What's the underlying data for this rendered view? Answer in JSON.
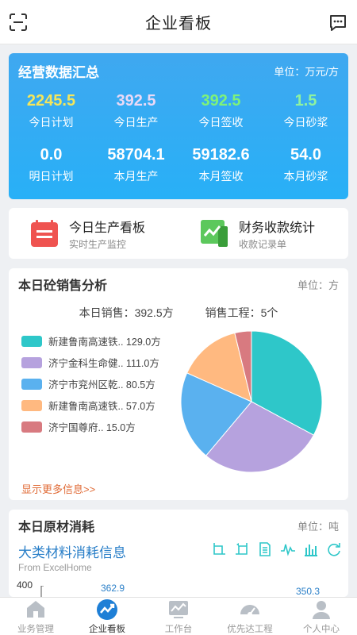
{
  "header": {
    "title": "企业看板",
    "scan_icon": "scan-icon",
    "message_icon": "message-icon"
  },
  "summary": {
    "title": "经营数据汇总",
    "unit": "单位：万元/方",
    "cells": [
      {
        "value": "2245.5",
        "label": "今日计划",
        "color": "#f5e65a"
      },
      {
        "value": "392.5",
        "label": "今日生产",
        "color": "#e9d9f6"
      },
      {
        "value": "392.5",
        "label": "今日签收",
        "color": "#7ef27a"
      },
      {
        "value": "1.5",
        "label": "今日砂浆",
        "color": "#8ef2a0"
      },
      {
        "value": "0.0",
        "label": "明日计划",
        "color": "#ffffff"
      },
      {
        "value": "58704.1",
        "label": "本月生产",
        "color": "#ffffff"
      },
      {
        "value": "59182.6",
        "label": "本月签收",
        "color": "#ffffff"
      },
      {
        "value": "54.0",
        "label": "本月砂浆",
        "color": "#ffffff"
      }
    ]
  },
  "boards": [
    {
      "title": "今日生产看板",
      "subtitle": "实时生产监控",
      "icon": "calendar-icon"
    },
    {
      "title": "财务收款统计",
      "subtitle": "收款记录单",
      "icon": "finance-chart-icon"
    }
  ],
  "sales": {
    "title": "本日砼销售分析",
    "unit": "单位：方",
    "total_sales": "本日销售：392.5方",
    "projects": "销售工程：5个",
    "more": "显示更多信息>>"
  },
  "chart_data": {
    "type": "pie",
    "labels": [
      "新建鲁南高速铁.. 129.0方",
      "济宁金科生命健.. 111.0方",
      "济宁市兖州区乾.. 80.5方",
      "新建鲁南高速铁.. 57.0方",
      "济宁国尊府.. 15.0方"
    ],
    "values": [
      129.0,
      111.0,
      80.5,
      57.0,
      15.0
    ],
    "colors": [
      "#2ec7c9",
      "#b6a2de",
      "#5ab1ef",
      "#ffb980",
      "#d87a80"
    ],
    "legend": "left"
  },
  "material": {
    "title": "本日原材消耗",
    "unit": "单位：吨",
    "chart_title": "大类材料消耗信息",
    "chart_subtitle": "From ExcelHome",
    "y_max": "400",
    "data_label_1": "362.9",
    "data_label_2": "350.3"
  },
  "tabs": [
    {
      "label": "业务管理",
      "icon": "home-icon",
      "active": false
    },
    {
      "label": "企业看板",
      "icon": "trend-icon",
      "active": true
    },
    {
      "label": "工作台",
      "icon": "workbench-icon",
      "active": false
    },
    {
      "label": "优先达工程",
      "icon": "gauge-icon",
      "active": false
    },
    {
      "label": "个人中心",
      "icon": "person-icon",
      "active": false
    }
  ]
}
